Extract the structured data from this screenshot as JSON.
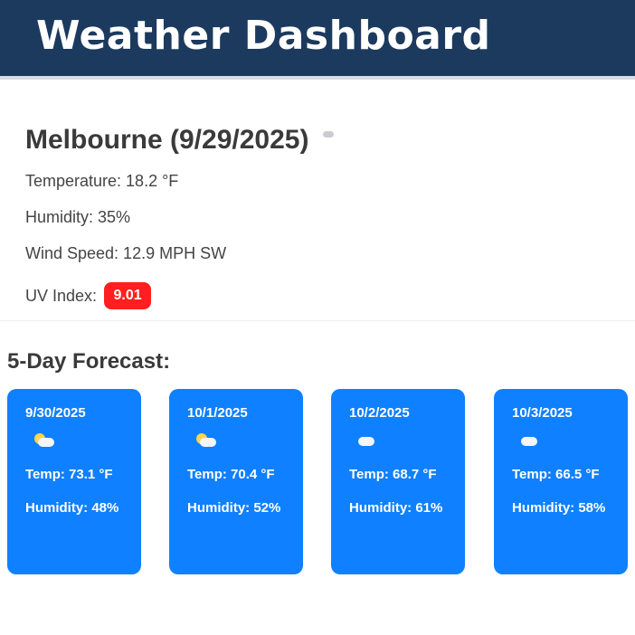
{
  "header": {
    "title": "Weather Dashboard"
  },
  "current": {
    "city_title": "Melbourne (9/29/2025)",
    "condition_icon": "cloud-icon",
    "temperature": "Temperature: 18.2 °F",
    "humidity": "Humidity: 35%",
    "wind_speed": "Wind Speed: 12.9 MPH SW",
    "uv_label": "UV Index:",
    "uv_value": "9.01",
    "uv_color": "#ff1f1f"
  },
  "forecast": {
    "title": "5-Day Forecast:",
    "cards": [
      {
        "date": "9/30/2025",
        "icon": "partly-cloudy-icon",
        "temp": "Temp: 73.1 °F",
        "humidity": "Humidity: 48%"
      },
      {
        "date": "10/1/2025",
        "icon": "partly-cloudy-icon",
        "temp": "Temp: 70.4 °F",
        "humidity": "Humidity: 52%"
      },
      {
        "date": "10/2/2025",
        "icon": "cloudy-icon",
        "temp": "Temp: 68.7 °F",
        "humidity": "Humidity: 61%"
      },
      {
        "date": "10/3/2025",
        "icon": "cloudy-icon",
        "temp": "Temp: 66.5 °F",
        "humidity": "Humidity: 58%"
      }
    ]
  },
  "colors": {
    "header_bg": "#1c3a5e",
    "card_bg": "#0f80ff",
    "uv_high": "#ff1f1f"
  }
}
